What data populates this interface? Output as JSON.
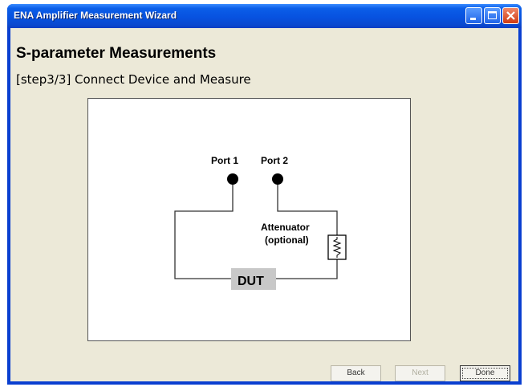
{
  "window": {
    "title": "ENA Amplifier Measurement Wizard"
  },
  "content": {
    "heading": "S-parameter Measurements",
    "subheading": "[step3/3] Connect Device and Measure"
  },
  "diagram": {
    "port1_label": "Port 1",
    "port2_label": "Port 2",
    "attenuator_label_line1": "Attenuator",
    "attenuator_label_line2": "(optional)",
    "dut_label": "DUT"
  },
  "buttons": {
    "back": "Back",
    "next": "Next",
    "done": "Done"
  }
}
